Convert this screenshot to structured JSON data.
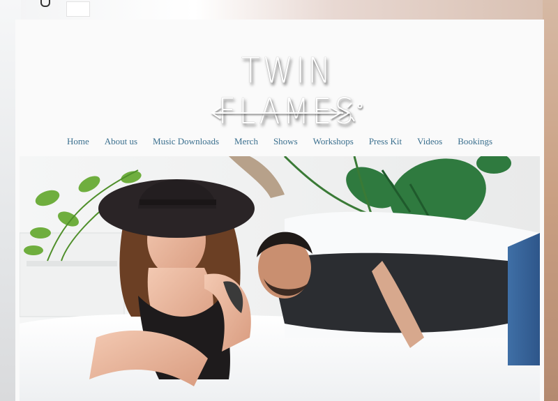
{
  "site": {
    "logo_text": "TWIN FLAMES",
    "logo_icon": "arrow-logo-icon"
  },
  "nav": {
    "items": [
      {
        "label": "Home"
      },
      {
        "label": "About us"
      },
      {
        "label": "Music Downloads"
      },
      {
        "label": "Merch"
      },
      {
        "label": "Shows"
      },
      {
        "label": "Workshops"
      },
      {
        "label": "Press Kit"
      },
      {
        "label": "Videos"
      },
      {
        "label": "Bookings"
      }
    ],
    "link_color": "#3a6f8e"
  },
  "hero": {
    "image": "band-photo"
  }
}
